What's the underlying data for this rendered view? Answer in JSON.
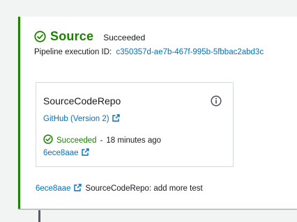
{
  "stage": {
    "name": "Source",
    "status": "Succeeded",
    "execution_label": "Pipeline execution ID:",
    "execution_id": "c350357d-ae7b-467f-995b-5fbbac2abd3c",
    "accent_color": "#1d8102"
  },
  "action": {
    "name": "SourceCodeRepo",
    "provider": "GitHub (Version 2)",
    "status": "Succeeded",
    "separator": "-",
    "time_ago": "18 minutes ago",
    "commit_id": "6ece8aae",
    "info_icon": "info-icon"
  },
  "footer": {
    "commit_id": "6ece8aae",
    "message": "SourceCodeRepo: add more test"
  },
  "colors": {
    "link": "#0073bb",
    "success": "#1d8102",
    "text": "#16191f"
  }
}
